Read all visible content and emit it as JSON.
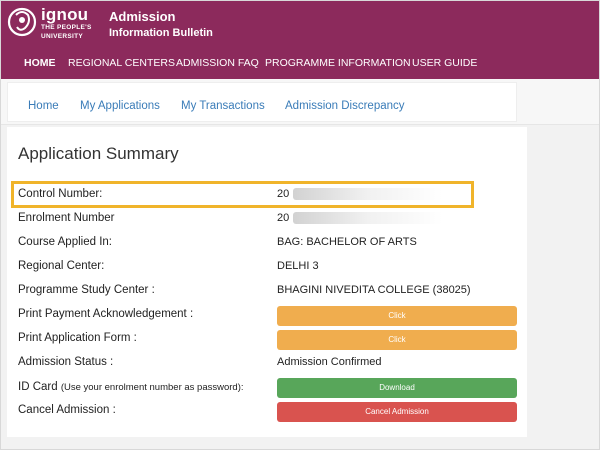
{
  "header": {
    "logo_big": "ignou",
    "logo_sub1": "THE PEOPLE'S",
    "logo_sub2": "UNIVERSITY",
    "title_line1": "Admission",
    "title_line2": "Information Bulletin",
    "brand_color": "#8c2a5c"
  },
  "main_nav": {
    "items": [
      "HOME",
      "REGIONAL CENTERS",
      "ADMISSION FAQ",
      "PROGRAMME INFORMATION",
      "USER GUIDE"
    ]
  },
  "sub_nav": {
    "items": [
      "Home",
      "My Applications",
      "My Transactions",
      "Admission Discrepancy"
    ]
  },
  "summary": {
    "title": "Application Summary",
    "control_number_label": "Control Number:",
    "control_number_value": "20",
    "enrolment_label": "Enrolment Number",
    "enrolment_value": "20",
    "course_label": "Course Applied In:",
    "course_value": "BAG: BACHELOR OF ARTS",
    "regional_label": "Regional Center:",
    "regional_value": "DELHI 3",
    "study_center_label": "Programme Study Center :",
    "study_center_value": "BHAGINI NIVEDITA COLLEGE (38025)",
    "print_ack_label": "Print Payment Acknowledgement :",
    "print_ack_button": "Click",
    "print_form_label": "Print Application Form :",
    "print_form_button": "Click",
    "status_label": "Admission Status :",
    "status_value": "Admission Confirmed",
    "idcard_label": "ID Card",
    "idcard_note": "(Use your enrolment number as password):",
    "idcard_button": "Download",
    "cancel_label": "Cancel Admission :",
    "cancel_button": "Cancel Admission"
  }
}
